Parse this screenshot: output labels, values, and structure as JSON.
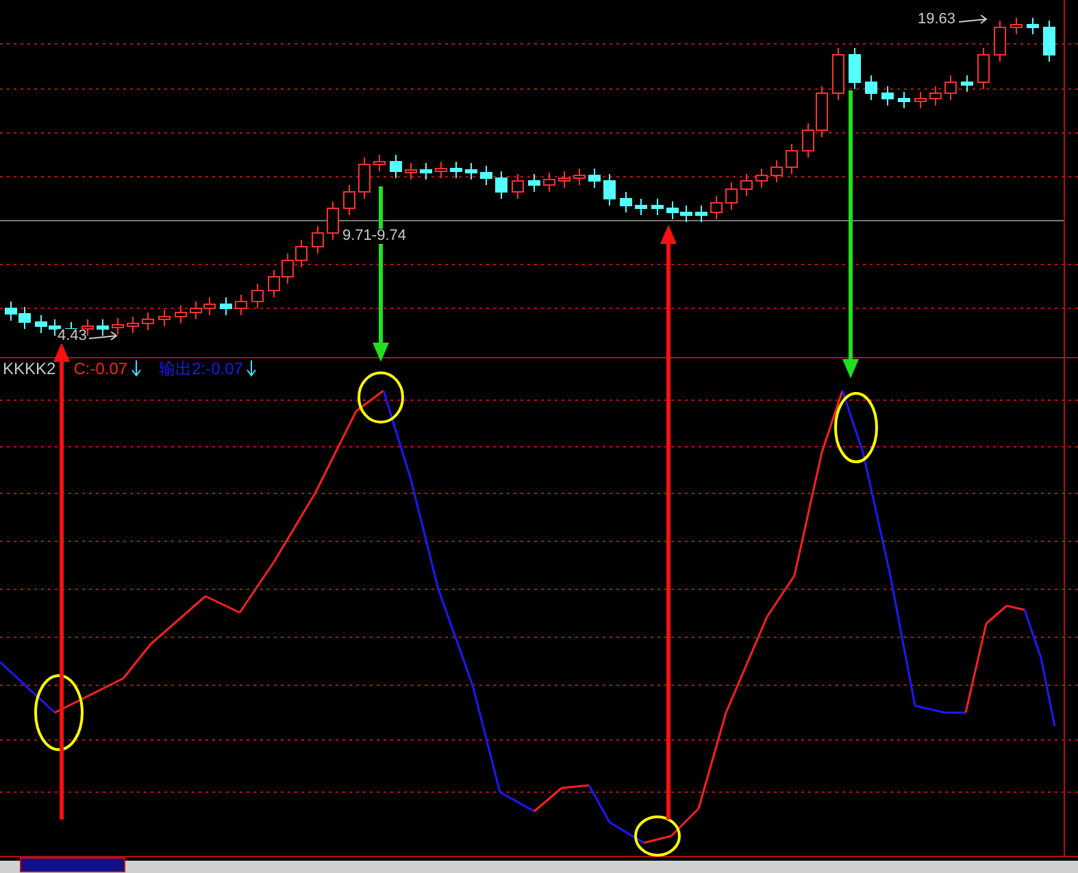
{
  "price_panel": {
    "labels": [
      {
        "text": "4.43",
        "kind": "arrow-right"
      },
      {
        "text": "9.71-9.74",
        "kind": "plain"
      },
      {
        "text": "19.63",
        "kind": "arrow-right"
      }
    ]
  },
  "indicator_panel": {
    "name": "KKKK2",
    "values": [
      {
        "text": "C:-0.07",
        "color": "#ff2020"
      },
      {
        "text": "输出2:-0.07",
        "color": "#1a1aff"
      }
    ]
  }
}
